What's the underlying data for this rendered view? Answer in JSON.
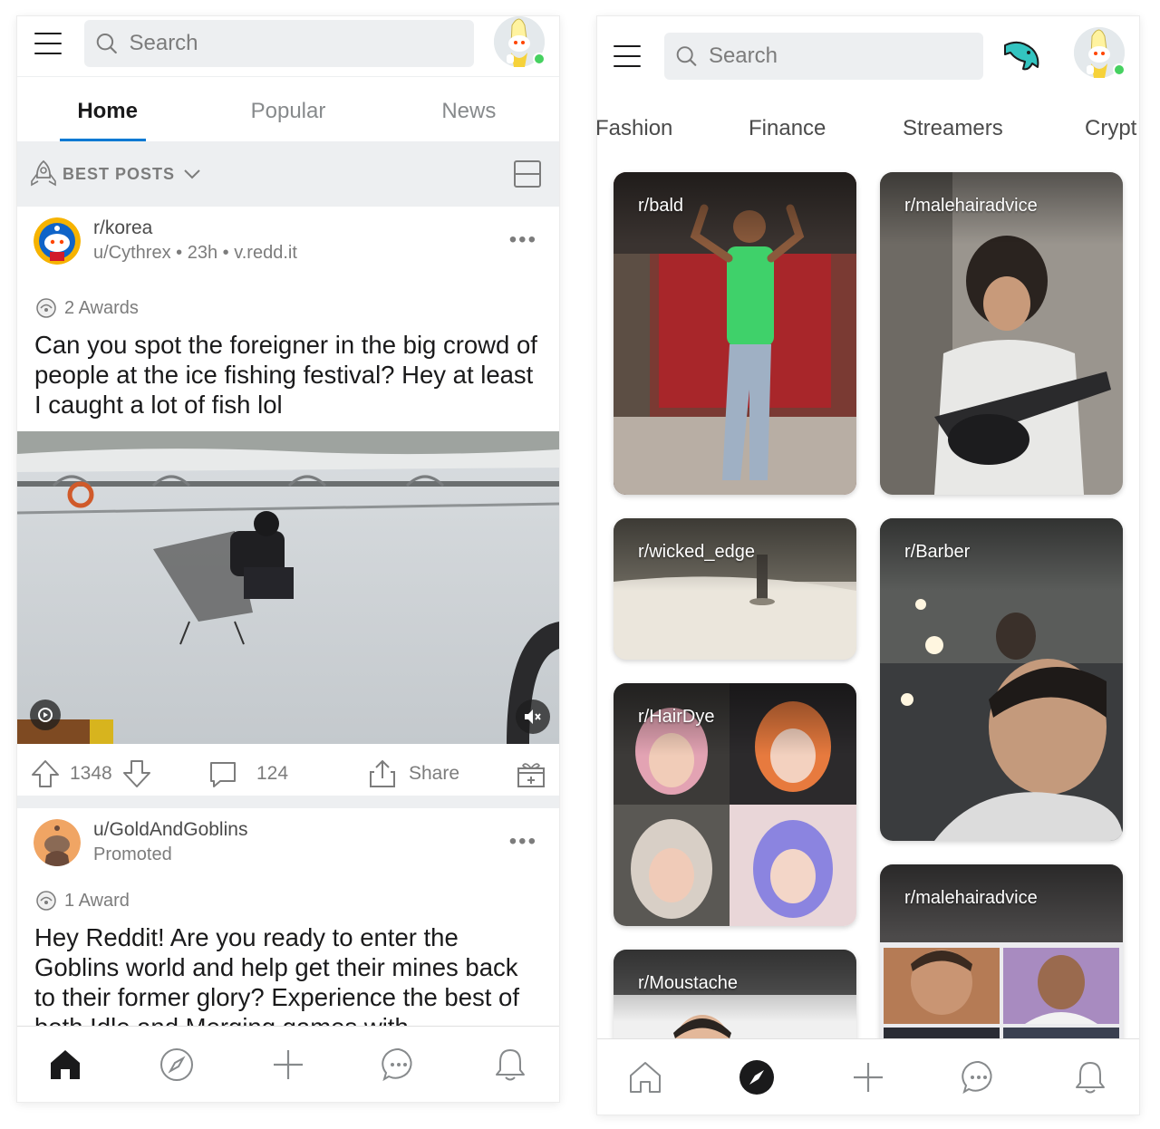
{
  "left": {
    "search": {
      "placeholder": "Search"
    },
    "tabs": [
      {
        "label": "Home",
        "active": true
      },
      {
        "label": "Popular",
        "active": false
      },
      {
        "label": "News",
        "active": false
      }
    ],
    "sort": {
      "label": "BEST POSTS"
    },
    "post1": {
      "subreddit": "r/korea",
      "user": "u/Cythrex",
      "age": "23h",
      "domain": "v.redd.it",
      "awards": "2 Awards",
      "title": "Can you spot the foreigner in the big crowd of people at the ice fishing festival? Hey at least I caught a lot of fish lol",
      "upvotes": "1348",
      "comments": "124",
      "share_label": "Share"
    },
    "post2": {
      "user": "u/GoldAndGoblins",
      "promoted": "Promoted",
      "awards": "1 Award",
      "title": "Hey Reddit! Are you ready to enter the Goblins world and help get their mines back to their former glory? Experience the best of both Idle and Merging games with"
    }
  },
  "right": {
    "search": {
      "placeholder": "Search"
    },
    "categories": [
      "Fashion",
      "Finance",
      "Streamers",
      "Crypt"
    ],
    "tiles": [
      {
        "label": "r/bald"
      },
      {
        "label": "r/malehairadvice"
      },
      {
        "label": "r/wicked_edge"
      },
      {
        "label": "r/Barber"
      },
      {
        "label": "r/HairDye"
      },
      {
        "label": "r/malehairadvice"
      },
      {
        "label": "r/Moustache"
      }
    ]
  },
  "colors": {
    "accent_blue": "#0079d3",
    "online_green": "#46d160",
    "text_primary": "#1a1a1b",
    "text_secondary": "#7c7c7c",
    "background_gray": "#edeff1"
  }
}
